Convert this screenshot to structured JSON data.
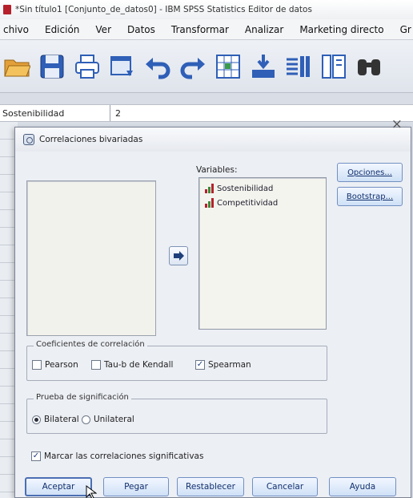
{
  "window": {
    "title": "*Sin título1 [Conjunto_de_datos0] - IBM SPSS Statistics Editor de datos"
  },
  "menubar": {
    "items": [
      {
        "label": "chivo"
      },
      {
        "label": "Edición"
      },
      {
        "label": "Ver"
      },
      {
        "label": "Datos"
      },
      {
        "label": "Transformar"
      },
      {
        "label": "Analizar"
      },
      {
        "label": "Marketing directo"
      },
      {
        "label": "Gr"
      }
    ]
  },
  "toolbar": {
    "icons": [
      "open-folder-icon",
      "save-icon",
      "print-icon",
      "dialog-recall-icon",
      "undo-icon",
      "redo-icon",
      "goto-case-icon",
      "goto-variable-icon",
      "variables-icon",
      "split-file-icon",
      "find-icon"
    ]
  },
  "cellbar": {
    "name": "Sostenibilidad",
    "value": "2"
  },
  "dialog": {
    "title": "Correlaciones bivariadas",
    "close": "×",
    "variables_label": "Variables:",
    "variables": [
      {
        "name": "Sostenibilidad",
        "icon": "scale-variable-icon"
      },
      {
        "name": "Competitividad",
        "icon": "scale-variable-icon"
      }
    ],
    "buttons": {
      "options": "Opciones...",
      "bootstrap": "Bootstrap..."
    },
    "correlation": {
      "legend": "Coeficientes de correlación",
      "pearson": {
        "label": "Pearson",
        "checked": false
      },
      "kendall": {
        "label": "Tau-b de Kendall",
        "checked": false
      },
      "spearman": {
        "label": "Spearman",
        "checked": true
      }
    },
    "significance": {
      "legend": "Prueba de significación",
      "bilateral": {
        "label": "Bilateral",
        "selected": true
      },
      "unilateral": {
        "label": "Unilateral",
        "selected": false
      }
    },
    "flag": {
      "label": "Marcar las correlaciones significativas",
      "checked": true
    },
    "actions": {
      "accept": "Aceptar",
      "paste": "Pegar",
      "reset": "Restablecer",
      "cancel": "Cancelar",
      "help": "Ayuda"
    }
  },
  "colors": {
    "button_text": "#12306e",
    "button_border": "#7290c2",
    "dialog_bg": "#eceff4",
    "scale_icon": "#b6202b"
  }
}
